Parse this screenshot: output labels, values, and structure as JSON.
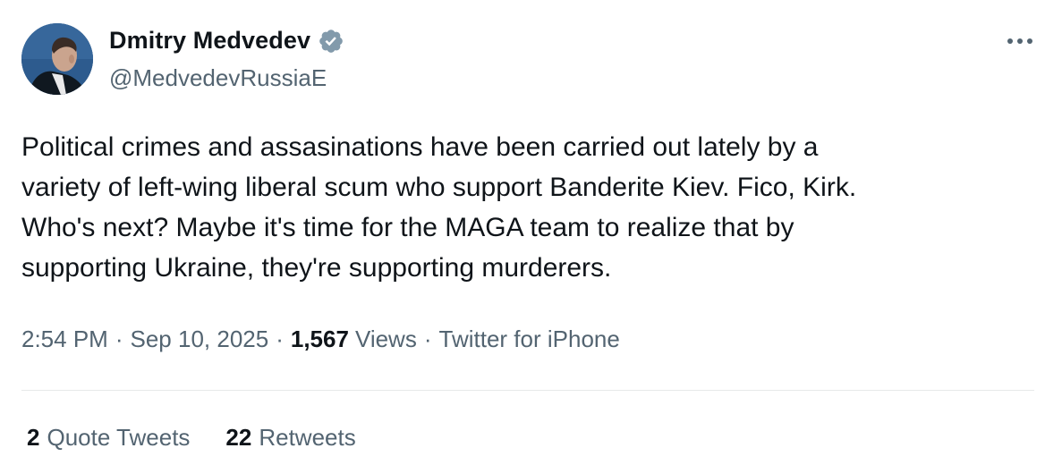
{
  "author": {
    "display_name": "Dmitry Medvedev",
    "handle": "@MedvedevRussiaE",
    "verified": true,
    "badge_color": "#829aab"
  },
  "tweet": {
    "text": "Political crimes and assasinations have been carried out lately by a\nvariety of left-wing liberal scum who support Banderite Kiev. Fico, Kirk.\nWho's next? Maybe it's time for the MAGA team to realize that by\nsupporting Ukraine, they're supporting murderers."
  },
  "meta": {
    "time": "2:54 PM",
    "separator": "·",
    "date": "Sep 10, 2025",
    "views_count": "1,567",
    "views_label": "Views",
    "source": "Twitter for iPhone"
  },
  "stats": {
    "quote_tweets_count": "2",
    "quote_tweets_label": "Quote Tweets",
    "retweets_count": "22",
    "retweets_label": "Retweets"
  },
  "icons": {
    "more": "more-options-icon",
    "verified": "verified-badge-icon"
  },
  "colors": {
    "text_primary": "#0f1419",
    "text_secondary": "#536471",
    "divider": "#e7e9ea"
  }
}
